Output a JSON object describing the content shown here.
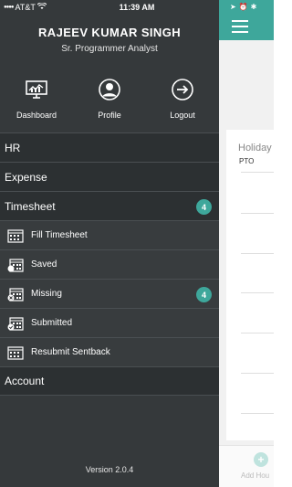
{
  "status": {
    "carrier": "AT&T",
    "time": "11:39 AM"
  },
  "profile": {
    "name": "RAJEEV KUMAR SINGH",
    "role": "Sr. Programmer Analyst"
  },
  "quick_actions": [
    {
      "label": "Dashboard",
      "icon": "dashboard-icon"
    },
    {
      "label": "Profile",
      "icon": "profile-icon"
    },
    {
      "label": "Logout",
      "icon": "logout-icon"
    }
  ],
  "menu": {
    "hr": "HR",
    "expense": "Expense",
    "timesheet": {
      "label": "Timesheet",
      "badge": "4"
    },
    "sub": [
      {
        "label": "Fill Timesheet"
      },
      {
        "label": "Saved"
      },
      {
        "label": "Missing",
        "badge": "4"
      },
      {
        "label": "Submitted"
      },
      {
        "label": "Resubmit Sentback"
      }
    ],
    "account": "Account"
  },
  "version": "Version 2.0.4",
  "background": {
    "card_title": "Holiday",
    "card_sub": "PTO",
    "add_label": "Add Hou"
  },
  "colors": {
    "accent": "#3ea79b",
    "drawer": "#35393b"
  }
}
